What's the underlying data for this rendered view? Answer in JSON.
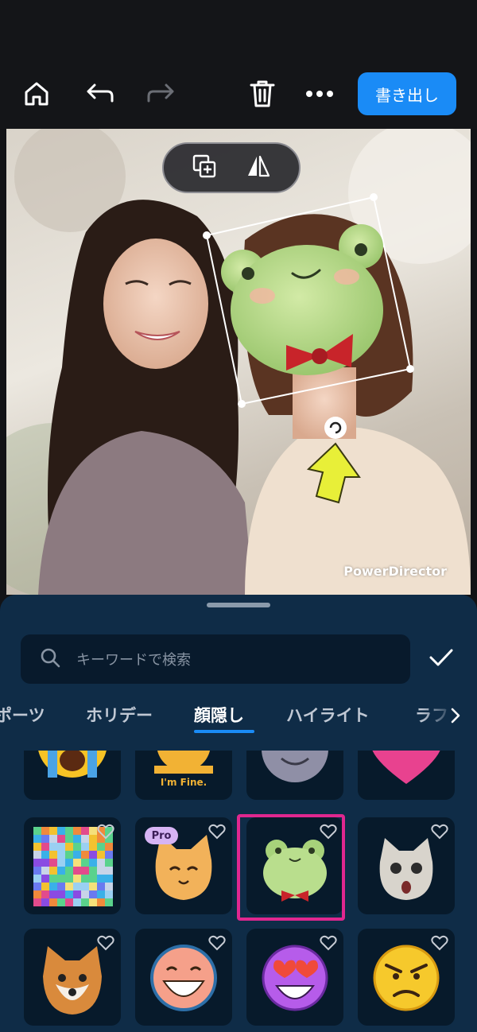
{
  "toolbar": {
    "home_icon": "home-icon",
    "undo_icon": "undo-icon",
    "redo_icon": "redo-icon",
    "delete_icon": "trash-icon",
    "more_icon": "more-icon",
    "export_label": "書き出し",
    "export_color": "#1a8bf6"
  },
  "canvas": {
    "watermark": "PowerDirector",
    "mini_toolbar": [
      "duplicate-icon",
      "flip-icon"
    ],
    "sticker": "frog-face-sticker"
  },
  "sheet": {
    "search_placeholder": "キーワードで検索",
    "confirm_icon": "check-icon",
    "tabs": [
      {
        "label": "ポーツ"
      },
      {
        "label": "ホリデー"
      },
      {
        "label": "顔隠し",
        "active": true
      },
      {
        "label": "ハイライト"
      },
      {
        "label": "ラフ"
      }
    ],
    "stickers": [
      {
        "name": "crying-face"
      },
      {
        "name": "im-fine-sticker",
        "label": "I'm Fine."
      },
      {
        "name": "moon-face"
      },
      {
        "name": "pixel-heart"
      },
      {
        "name": "mosaic-block"
      },
      {
        "name": "cat-face",
        "badge": "Pro"
      },
      {
        "name": "frog-face",
        "selected": true
      },
      {
        "name": "surprised-cat"
      },
      {
        "name": "shiba-dog"
      },
      {
        "name": "grin-face"
      },
      {
        "name": "heart-eyes-face"
      },
      {
        "name": "angry-face"
      }
    ],
    "highlight_color": "#e0278f"
  }
}
